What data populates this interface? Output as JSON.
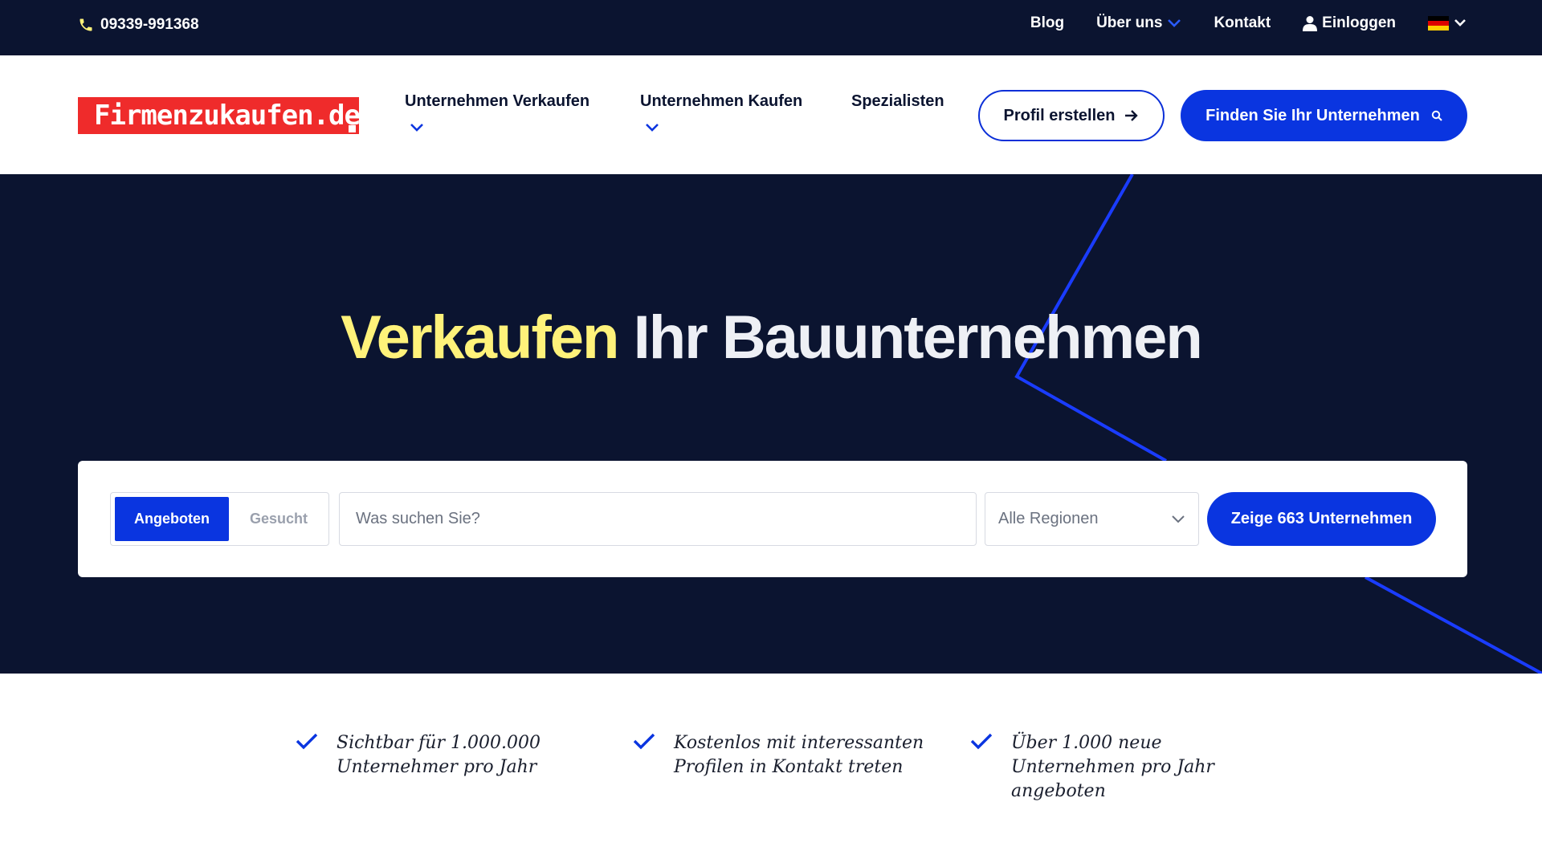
{
  "topbar": {
    "phone": "09339-991368",
    "links": {
      "blog": "Blog",
      "about": "Über uns",
      "contact": "Kontakt",
      "login": "Einloggen"
    },
    "language": "de"
  },
  "header": {
    "logo_text": "Firmenzukaufen.de",
    "nav": {
      "sell": "Unternehmen Verkaufen",
      "buy": "Unternehmen Kaufen",
      "specialists": "Spezialisten"
    },
    "profile_button": "Profil erstellen",
    "find_button": "Finden Sie Ihr Unternehmen"
  },
  "hero": {
    "headline_highlight": "Verkaufen",
    "headline_rest": "Ihr Bauunternehmen",
    "toggle": {
      "active": "Angeboten",
      "inactive": "Gesucht"
    },
    "search_placeholder": "Was suchen Sie?",
    "region_selected": "Alle Regionen",
    "show_button": "Zeige 663 Unternehmen"
  },
  "benefits": [
    {
      "line1": "Sichtbar für 1.000.000",
      "line2": "Unternehmer pro Jahr",
      "line3": ""
    },
    {
      "line1": "Kostenlos mit interessanten",
      "line2": "Profilen in Kontakt treten",
      "line3": ""
    },
    {
      "line1": "Über 1.000 neue",
      "line2": "Unternehmen pro Jahr",
      "line3": "angeboten"
    }
  ],
  "colors": {
    "navy": "#0b1430",
    "primary_blue": "#0a35e0",
    "headline_yellow": "#fff27a",
    "logo_red": "#ef2b2b"
  }
}
